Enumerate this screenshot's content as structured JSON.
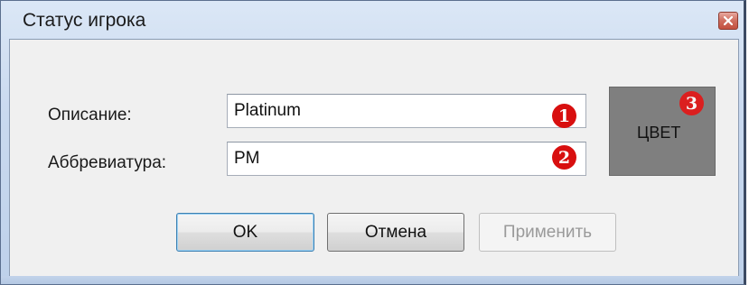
{
  "window": {
    "title": "Статус игрока"
  },
  "form": {
    "description_label": "Описание:",
    "description_value": "Platinum",
    "abbreviation_label": "Аббревиатура:",
    "abbreviation_value": "PM",
    "color_label": "ЦВЕТ",
    "color_swatch": "#7f7f7f"
  },
  "badges": [
    "1",
    "2",
    "3"
  ],
  "buttons": {
    "ok": "OK",
    "cancel": "Отмена",
    "apply": "Применить"
  },
  "icons": {
    "close": "close-icon"
  }
}
